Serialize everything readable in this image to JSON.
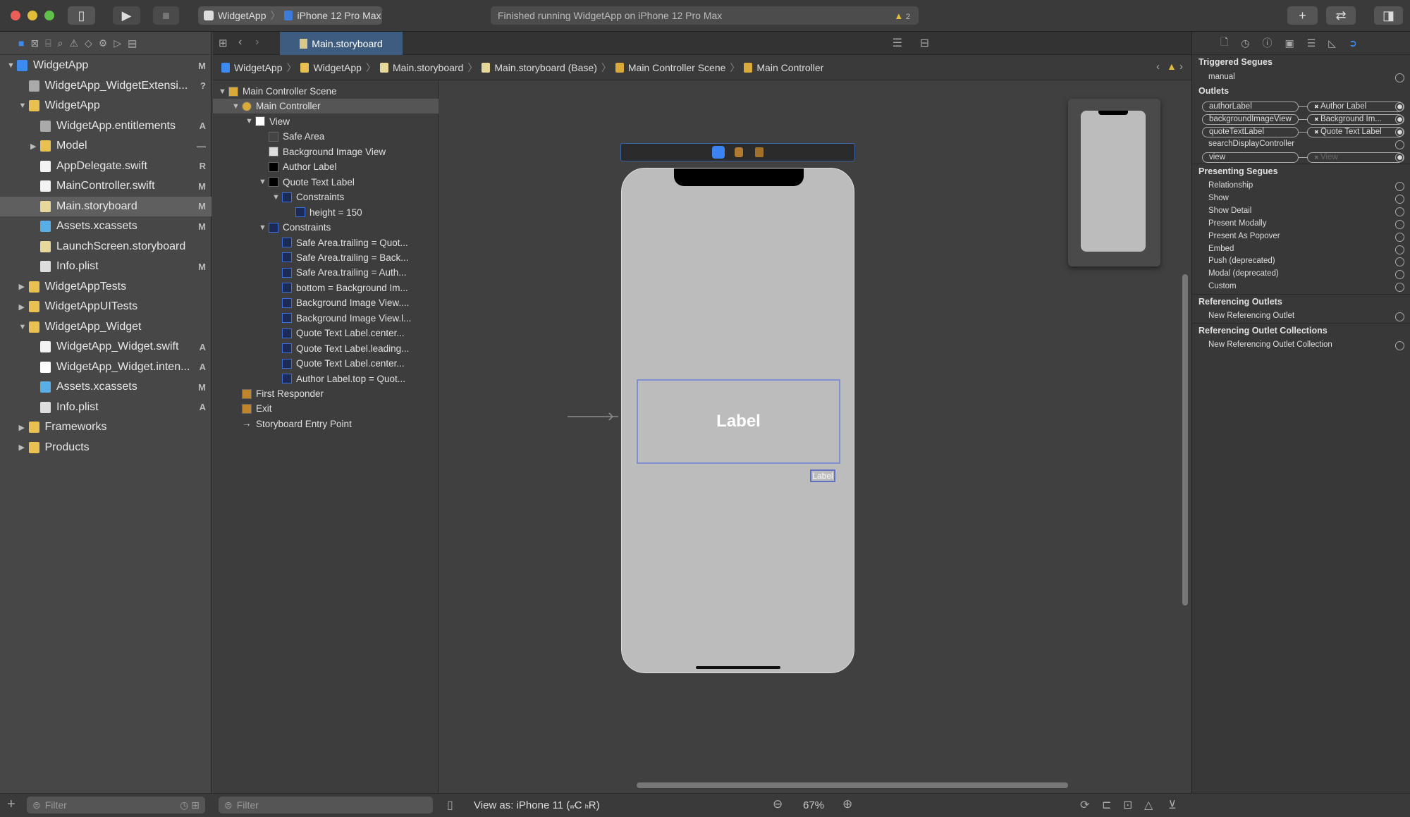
{
  "toolbar": {
    "scheme": "WidgetApp",
    "device": "iPhone 12 Pro Max",
    "activity": "Finished running WidgetApp on iPhone 12 Pro Max",
    "warnings": "2",
    "colors": {
      "close": "#ec5f58",
      "minimize": "#e2bd3a",
      "zoom": "#5fc04a"
    }
  },
  "navigator": {
    "items": [
      {
        "label": "WidgetApp",
        "level": 0,
        "disclosure": "open",
        "icon": "project-icon",
        "badge": "M"
      },
      {
        "label": "WidgetApp_WidgetExtensi...",
        "level": 1,
        "disclosure": "none",
        "icon": "file-icon",
        "badge": "?"
      },
      {
        "label": "WidgetApp",
        "level": 1,
        "disclosure": "open",
        "icon": "folder-icon",
        "badge": ""
      },
      {
        "label": "WidgetApp.entitlements",
        "level": 2,
        "disclosure": "none",
        "icon": "file-icon",
        "badge": "A"
      },
      {
        "label": "Model",
        "level": 2,
        "disclosure": "closed",
        "icon": "folder-icon",
        "badge": "—"
      },
      {
        "label": "AppDelegate.swift",
        "level": 2,
        "disclosure": "none",
        "icon": "swift-icon",
        "badge": "R"
      },
      {
        "label": "MainController.swift",
        "level": 2,
        "disclosure": "none",
        "icon": "swift-icon",
        "badge": "M"
      },
      {
        "label": "Main.storyboard",
        "level": 2,
        "disclosure": "none",
        "icon": "storyboard-icon",
        "badge": "M",
        "selected": true
      },
      {
        "label": "Assets.xcassets",
        "level": 2,
        "disclosure": "none",
        "icon": "assets-icon",
        "badge": "M"
      },
      {
        "label": "LaunchScreen.storyboard",
        "level": 2,
        "disclosure": "none",
        "icon": "storyboard-icon",
        "badge": ""
      },
      {
        "label": "Info.plist",
        "level": 2,
        "disclosure": "none",
        "icon": "plist-icon",
        "badge": "M"
      },
      {
        "label": "WidgetAppTests",
        "level": 1,
        "disclosure": "closed",
        "icon": "folder-icon",
        "badge": ""
      },
      {
        "label": "WidgetAppUITests",
        "level": 1,
        "disclosure": "closed",
        "icon": "folder-icon",
        "badge": ""
      },
      {
        "label": "WidgetApp_Widget",
        "level": 1,
        "disclosure": "open",
        "icon": "folder-icon",
        "badge": ""
      },
      {
        "label": "WidgetApp_Widget.swift",
        "level": 2,
        "disclosure": "none",
        "icon": "swift-icon",
        "badge": "A"
      },
      {
        "label": "WidgetApp_Widget.inten...",
        "level": 2,
        "disclosure": "none",
        "icon": "intent-icon",
        "badge": "A"
      },
      {
        "label": "Assets.xcassets",
        "level": 2,
        "disclosure": "none",
        "icon": "assets-icon",
        "badge": "M"
      },
      {
        "label": "Info.plist",
        "level": 2,
        "disclosure": "none",
        "icon": "plist-icon",
        "badge": "A"
      },
      {
        "label": "Frameworks",
        "level": 1,
        "disclosure": "closed",
        "icon": "folder-icon",
        "badge": ""
      },
      {
        "label": "Products",
        "level": 1,
        "disclosure": "closed",
        "icon": "folder-icon",
        "badge": ""
      }
    ],
    "filter_placeholder": "Filter"
  },
  "editor": {
    "tab": "Main.storyboard",
    "breadcrumb": [
      "WidgetApp",
      "WidgetApp",
      "Main.storyboard",
      "Main.storyboard (Base)",
      "Main Controller Scene",
      "Main Controller"
    ]
  },
  "outline": {
    "items": [
      {
        "label": "Main Controller Scene",
        "level": 0,
        "disclosure": "open",
        "icon": "scene-icon"
      },
      {
        "label": "Main Controller",
        "level": 1,
        "disclosure": "open",
        "icon": "view-controller-icon",
        "selected": true
      },
      {
        "label": "View",
        "level": 2,
        "disclosure": "open",
        "icon": "view-icon"
      },
      {
        "label": "Safe Area",
        "level": 3,
        "disclosure": "none",
        "icon": "safe-area-icon"
      },
      {
        "label": "Background Image View",
        "level": 3,
        "disclosure": "none",
        "icon": "image-view-icon"
      },
      {
        "label": "Author Label",
        "level": 3,
        "disclosure": "none",
        "icon": "label-icon"
      },
      {
        "label": "Quote Text Label",
        "level": 3,
        "disclosure": "open",
        "icon": "label-icon"
      },
      {
        "label": "Constraints",
        "level": 4,
        "disclosure": "open",
        "icon": "constraints-icon"
      },
      {
        "label": "height = 150",
        "level": 5,
        "disclosure": "none",
        "icon": "constraint-icon"
      },
      {
        "label": "Constraints",
        "level": 3,
        "disclosure": "open",
        "icon": "constraints-icon"
      },
      {
        "label": "Safe Area.trailing = Quot...",
        "level": 4,
        "disclosure": "none",
        "icon": "constraint-icon"
      },
      {
        "label": "Safe Area.trailing = Back...",
        "level": 4,
        "disclosure": "none",
        "icon": "constraint-icon"
      },
      {
        "label": "Safe Area.trailing = Auth...",
        "level": 4,
        "disclosure": "none",
        "icon": "constraint-icon"
      },
      {
        "label": "bottom = Background Im...",
        "level": 4,
        "disclosure": "none",
        "icon": "constraint-icon"
      },
      {
        "label": "Background Image View....",
        "level": 4,
        "disclosure": "none",
        "icon": "constraint-icon"
      },
      {
        "label": "Background Image View.l...",
        "level": 4,
        "disclosure": "none",
        "icon": "constraint-icon"
      },
      {
        "label": "Quote Text Label.center...",
        "level": 4,
        "disclosure": "none",
        "icon": "constraint-icon"
      },
      {
        "label": "Quote Text Label.leading...",
        "level": 4,
        "disclosure": "none",
        "icon": "constraint-icon"
      },
      {
        "label": "Quote Text Label.center...",
        "level": 4,
        "disclosure": "none",
        "icon": "constraint-icon"
      },
      {
        "label": "Author Label.top = Quot...",
        "level": 4,
        "disclosure": "none",
        "icon": "constraint-icon"
      },
      {
        "label": "First Responder",
        "level": 1,
        "disclosure": "none",
        "icon": "first-responder-icon"
      },
      {
        "label": "Exit",
        "level": 1,
        "disclosure": "none",
        "icon": "exit-icon"
      },
      {
        "label": "Storyboard Entry Point",
        "level": 1,
        "disclosure": "none",
        "icon": "arrow-right-icon"
      }
    ],
    "filter_placeholder": "Filter"
  },
  "canvas": {
    "quote_label": "Label",
    "author_label": "Label"
  },
  "bottom": {
    "view_as": "View as: iPhone 11 (",
    "size_w": "w",
    "size_c": "C",
    "size_h": "h",
    "size_r": "R)",
    "zoom": "67%"
  },
  "inspector": {
    "triggered_segues": {
      "title": "Triggered Segues",
      "items": [
        "manual"
      ]
    },
    "outlets": {
      "title": "Outlets",
      "items": [
        {
          "name": "authorLabel",
          "target": "Author Label",
          "connected": true
        },
        {
          "name": "backgroundImageView",
          "target": "Background Im...",
          "connected": true
        },
        {
          "name": "quoteTextLabel",
          "target": "Quote Text Label",
          "connected": true
        },
        {
          "name": "searchDisplayController",
          "target": "",
          "connected": false
        },
        {
          "name": "view",
          "target": "View",
          "connected": true,
          "dimmed": true
        }
      ]
    },
    "presenting_segues": {
      "title": "Presenting Segues",
      "items": [
        "Relationship",
        "Show",
        "Show Detail",
        "Present Modally",
        "Present As Popover",
        "Embed",
        "Push (deprecated)",
        "Modal (deprecated)",
        "Custom"
      ]
    },
    "referencing_outlets": {
      "title": "Referencing Outlets",
      "items": [
        "New Referencing Outlet"
      ]
    },
    "referencing_collections": {
      "title": "Referencing Outlet Collections",
      "items": [
        "New Referencing Outlet Collection"
      ]
    }
  }
}
